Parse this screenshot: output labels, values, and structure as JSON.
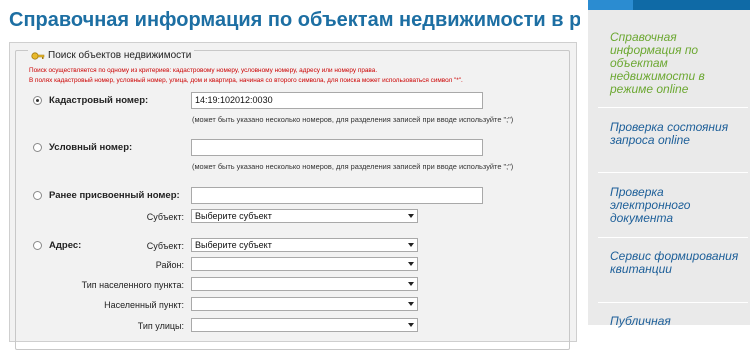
{
  "page": {
    "title": "Справочная информация по объектам недвижимости в режиме online"
  },
  "search": {
    "legend": "Поиск объектов недвижимости",
    "notice_line1": "Поиск осуществляется по одному из критериев: кадастровому номеру, условному номеру, адресу или номеру права.",
    "notice_line2": "В полях кадастровый номер, условный номер, улица, дом и квартира, начиная со второго символа, для поиска может использоваться символ \"*\".",
    "cadastral": {
      "label": "Кадастровый номер:",
      "value": "14:19:102012:0030",
      "hint": "(может быть указано несколько номеров, для разделения записей при вводе используйте \";\")"
    },
    "conditional": {
      "label": "Условный номер:",
      "value": "",
      "hint": "(может быть указано несколько номеров, для разделения записей при вводе используйте \";\")"
    },
    "previous": {
      "label": "Ранее присвоенный номер:",
      "value": "",
      "subject_label": "Субъект:",
      "subject_value": "Выберите субъект"
    },
    "address": {
      "label": "Адрес:",
      "subject_label": "Субъект:",
      "subject_value": "Выберите субъект",
      "district_label": "Район:",
      "district_value": "",
      "settlement_type_label": "Тип населенного пункта:",
      "settlement_type_value": "",
      "settlement_label": "Населенный пункт:",
      "settlement_value": "",
      "street_type_label": "Тип улицы:",
      "street_type_value": ""
    }
  },
  "sidebar": {
    "items": [
      {
        "label": "Справочная информация по объектам недвижимости в режиме online"
      },
      {
        "label": "Проверка состояния запроса online"
      },
      {
        "label": "Проверка электронного документа"
      },
      {
        "label": "Сервис формирования квитанции"
      },
      {
        "label": "Публичная"
      }
    ]
  },
  "colors": {
    "title": "#1d6fa3",
    "sidebar_active": "#6ca832",
    "sidebar_link": "#1d5f99",
    "notice": "#cc0000"
  }
}
